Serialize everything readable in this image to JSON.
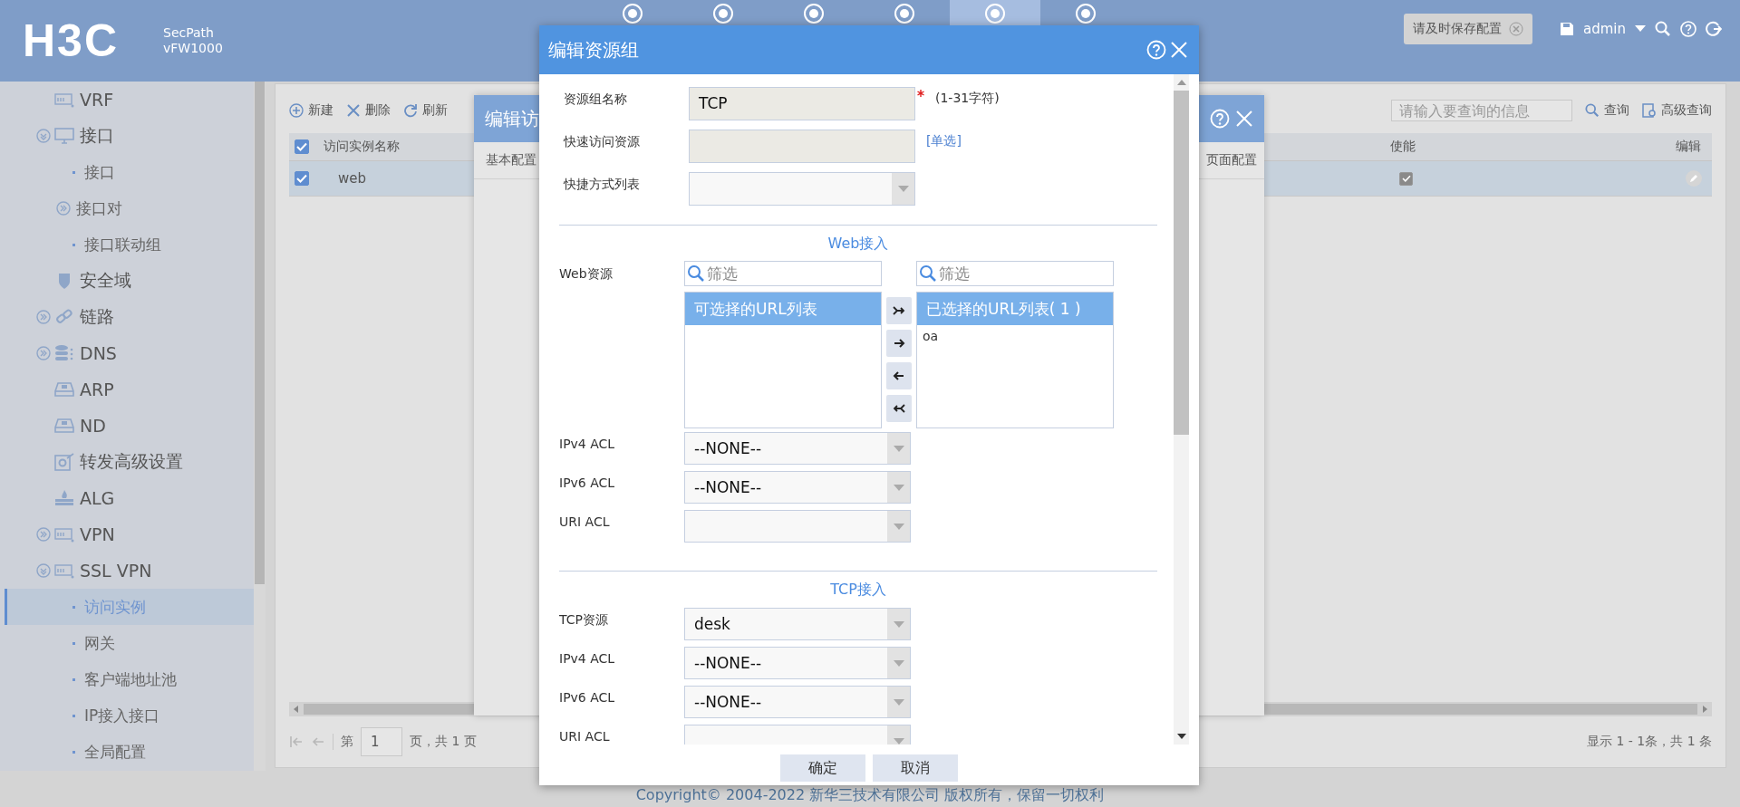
{
  "header": {
    "logo": "H3C",
    "product": "SecPath",
    "model": "vFW1000",
    "nav_tabs": [
      {
        "selected": false
      },
      {
        "selected": false
      },
      {
        "selected": false
      },
      {
        "selected": false
      },
      {
        "selected": true
      },
      {
        "selected": false
      }
    ],
    "notice": "请及时保存配置",
    "user": "admin"
  },
  "sidebar": {
    "items": [
      {
        "label": "VRF",
        "selected": false
      },
      {
        "label": "接口",
        "selected": false,
        "expanded": true,
        "children": [
          {
            "label": "接口",
            "selected": false
          },
          {
            "label": "接口对",
            "selected": false,
            "expanded": false
          },
          {
            "label": "接口联动组",
            "selected": false
          }
        ]
      },
      {
        "label": "安全域",
        "selected": false
      },
      {
        "label": "链路",
        "selected": false,
        "expanded": false
      },
      {
        "label": "DNS",
        "selected": false,
        "expanded": false
      },
      {
        "label": "ARP",
        "selected": false
      },
      {
        "label": "ND",
        "selected": false
      },
      {
        "label": "转发高级设置",
        "selected": false
      },
      {
        "label": "ALG",
        "selected": false
      },
      {
        "label": "VPN",
        "selected": false,
        "expanded": false
      },
      {
        "label": "SSL VPN",
        "selected": false,
        "expanded": true,
        "children": [
          {
            "label": "访问实例",
            "selected": true
          },
          {
            "label": "网关",
            "selected": false
          },
          {
            "label": "客户端地址池",
            "selected": false
          },
          {
            "label": "IP接入接口",
            "selected": false
          },
          {
            "label": "全局配置",
            "selected": false
          }
        ]
      }
    ]
  },
  "toolbar": {
    "buttons": [
      "新建",
      "删除",
      "刷新"
    ],
    "search_placeholder": "请输入要查询的信息",
    "search_button": "查询",
    "advanced_button": "高级查询"
  },
  "table": {
    "all_checked": true,
    "columns": [
      "访问实例名称",
      "使能",
      "编辑"
    ],
    "rows": [
      {
        "name": "web",
        "checked": true,
        "selected": true,
        "enabled": true
      }
    ]
  },
  "pagination": {
    "page_prefix": "第",
    "page": "1",
    "page_suffix": "页，共 1 页",
    "summary": "显示 1 - 1条，共 1 条"
  },
  "footer": "Copyright© 2004-2022 新华三技术有限公司 版权所有，保留一切权利",
  "back_dialog": {
    "title": "编辑访",
    "tabs": [
      "基本配置",
      "页面配置"
    ]
  },
  "dialog": {
    "title": "编辑资源组",
    "fields": [
      {
        "label": "资源组名称",
        "kind": "text",
        "value": "TCP",
        "required": true,
        "hint": "(1-31字符)"
      },
      {
        "label": "快速访问资源",
        "kind": "text",
        "required": false,
        "link": "[单选]"
      },
      {
        "label": "快捷方式列表",
        "kind": "select",
        "required": false
      }
    ],
    "sections": [
      {
        "title": "Web接入",
        "transfer": {
          "label": "Web资源",
          "left": {
            "placeholder": "筛选",
            "header": "可选择的URL列表"
          },
          "right": {
            "placeholder": "筛选",
            "header": "已选择的URL列表( 1 )",
            "items": [
              "oa"
            ]
          }
        },
        "fields": [
          {
            "label": "IPv4 ACL",
            "value": "--NONE--"
          },
          {
            "label": "IPv6 ACL",
            "value": "--NONE--"
          },
          {
            "label": "URI ACL"
          }
        ]
      },
      {
        "title": "TCP接入",
        "fields": [
          {
            "label": "TCP资源",
            "value": "desk"
          },
          {
            "label": "IPv4 ACL",
            "value": "--NONE--"
          },
          {
            "label": "IPv6 ACL",
            "value": "--NONE--"
          },
          {
            "label": "URI ACL"
          }
        ]
      }
    ],
    "buttons": [
      "确定",
      "取消"
    ]
  }
}
